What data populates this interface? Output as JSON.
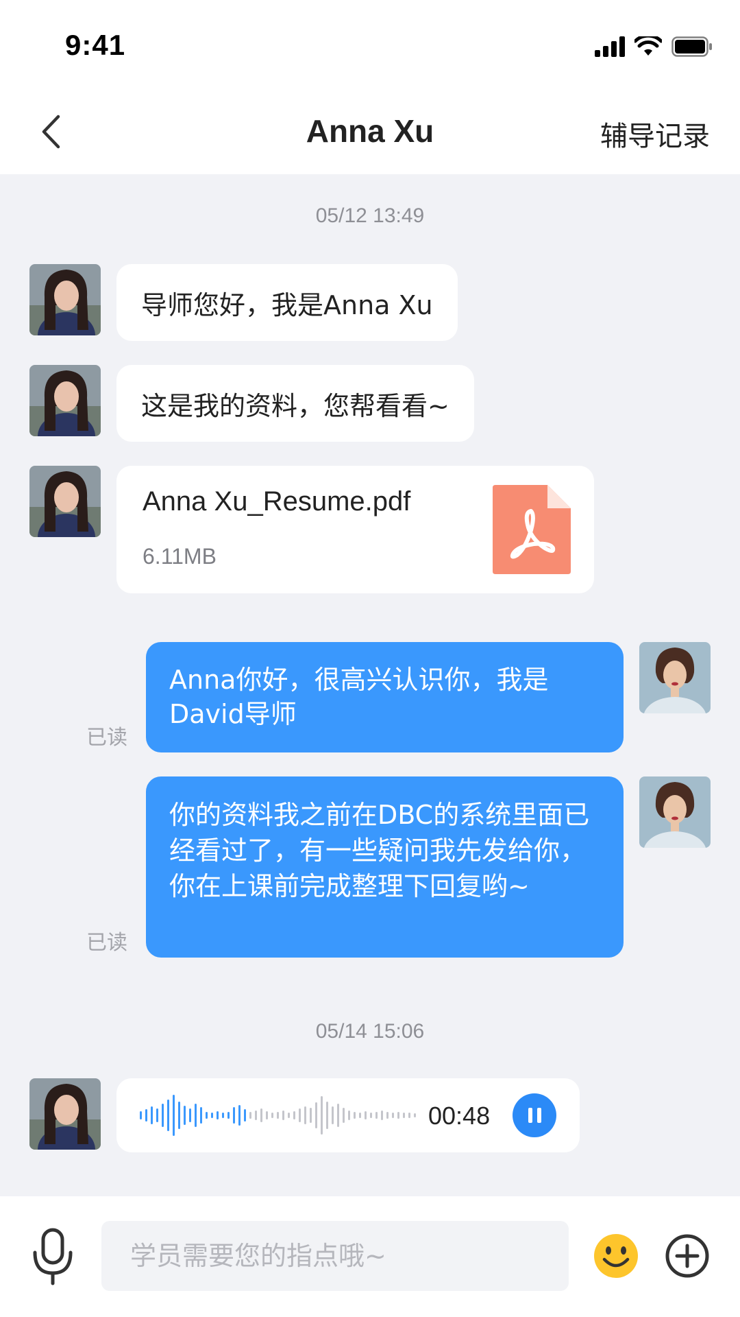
{
  "status_bar": {
    "time": "9:41"
  },
  "nav": {
    "title": "Anna Xu",
    "right_label": "辅导记录"
  },
  "timestamps": [
    "05/12 13:49",
    "05/14 15:06"
  ],
  "messages": {
    "m1": "导师您好，我是Anna Xu",
    "m2": "这是我的资料，您帮看看~",
    "file": {
      "name": "Anna Xu_Resume.pdf",
      "size": "6.11MB"
    },
    "out1": "Anna你好，很高兴认识你，我是David导师",
    "out2": "你的资料我之前在DBC的系统里面已经看过了，有一些疑问我先发给你，你在上课前完成整理下回复哟~",
    "read_label": "已读",
    "voice": {
      "duration": "00:48"
    }
  },
  "input": {
    "placeholder": "学员需要您的指点哦~"
  },
  "colors": {
    "accent": "#3a98fd",
    "pdf": "#f78c72",
    "emoji": "#fdc52c"
  }
}
